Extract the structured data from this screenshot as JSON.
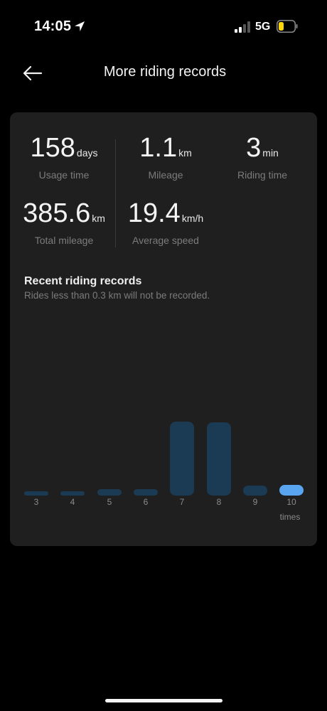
{
  "status_bar": {
    "time": "14:05",
    "network": "5G"
  },
  "header": {
    "title": "More riding records"
  },
  "stats": [
    {
      "value": "158",
      "unit": "days",
      "label": "Usage time"
    },
    {
      "value": "1.1",
      "unit": "km",
      "label": "Mileage"
    },
    {
      "value": "3",
      "unit": "min",
      "label": "Riding time"
    },
    {
      "value": "385.6",
      "unit": "km",
      "label": "Total mileage"
    },
    {
      "value": "19.4",
      "unit": "km/h",
      "label": "Average speed"
    }
  ],
  "records": {
    "title": "Recent riding records",
    "note": "Rides less than 0.3 km will not be recorded."
  },
  "chart_data": {
    "type": "bar",
    "categories": [
      "3",
      "4",
      "5",
      "6",
      "7",
      "8",
      "9",
      "10"
    ],
    "values": [
      0.06,
      0.04,
      0.09,
      0.09,
      1.0,
      0.99,
      0.13,
      0.14
    ],
    "value_scale": "relative, unlabeled y-axis (1 = tallest bar)",
    "x_unit": "times",
    "highlighted_category": "10",
    "colors": {
      "bar": "#1b3b54",
      "highlight": "#5aa5f0"
    }
  }
}
